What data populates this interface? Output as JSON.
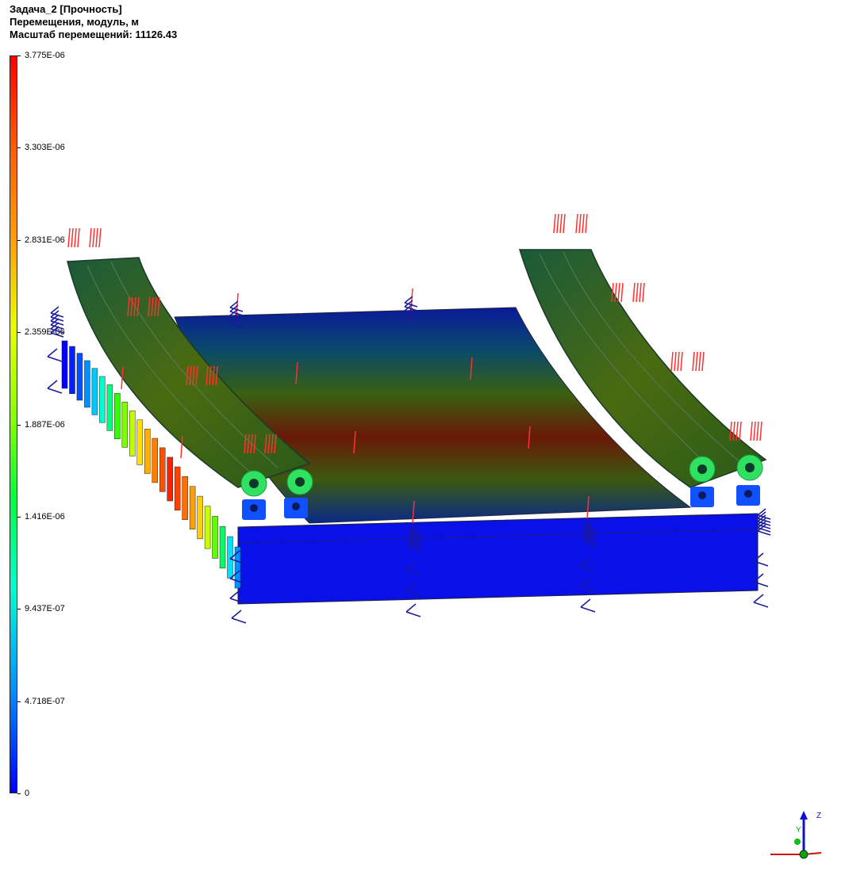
{
  "header": {
    "title": "Задача_2 [Прочность]",
    "result": "Перемещения, модуль, м",
    "scale_label": "Масштаб перемещений: 11126.43"
  },
  "legend": {
    "ticks": [
      "3.775E-06",
      "3.303E-06",
      "2.831E-06",
      "2.359E-06",
      "1.887E-06",
      "1.416E-06",
      "9.437E-07",
      "4.718E-07",
      "0"
    ],
    "colors": [
      "#ff0000",
      "#ff5a00",
      "#ffa000",
      "#e8ff00",
      "#80ff00",
      "#00ff40",
      "#00ffd0",
      "#0090ff",
      "#0000ff"
    ]
  },
  "triad": {
    "z": "Z",
    "y": "Y"
  }
}
